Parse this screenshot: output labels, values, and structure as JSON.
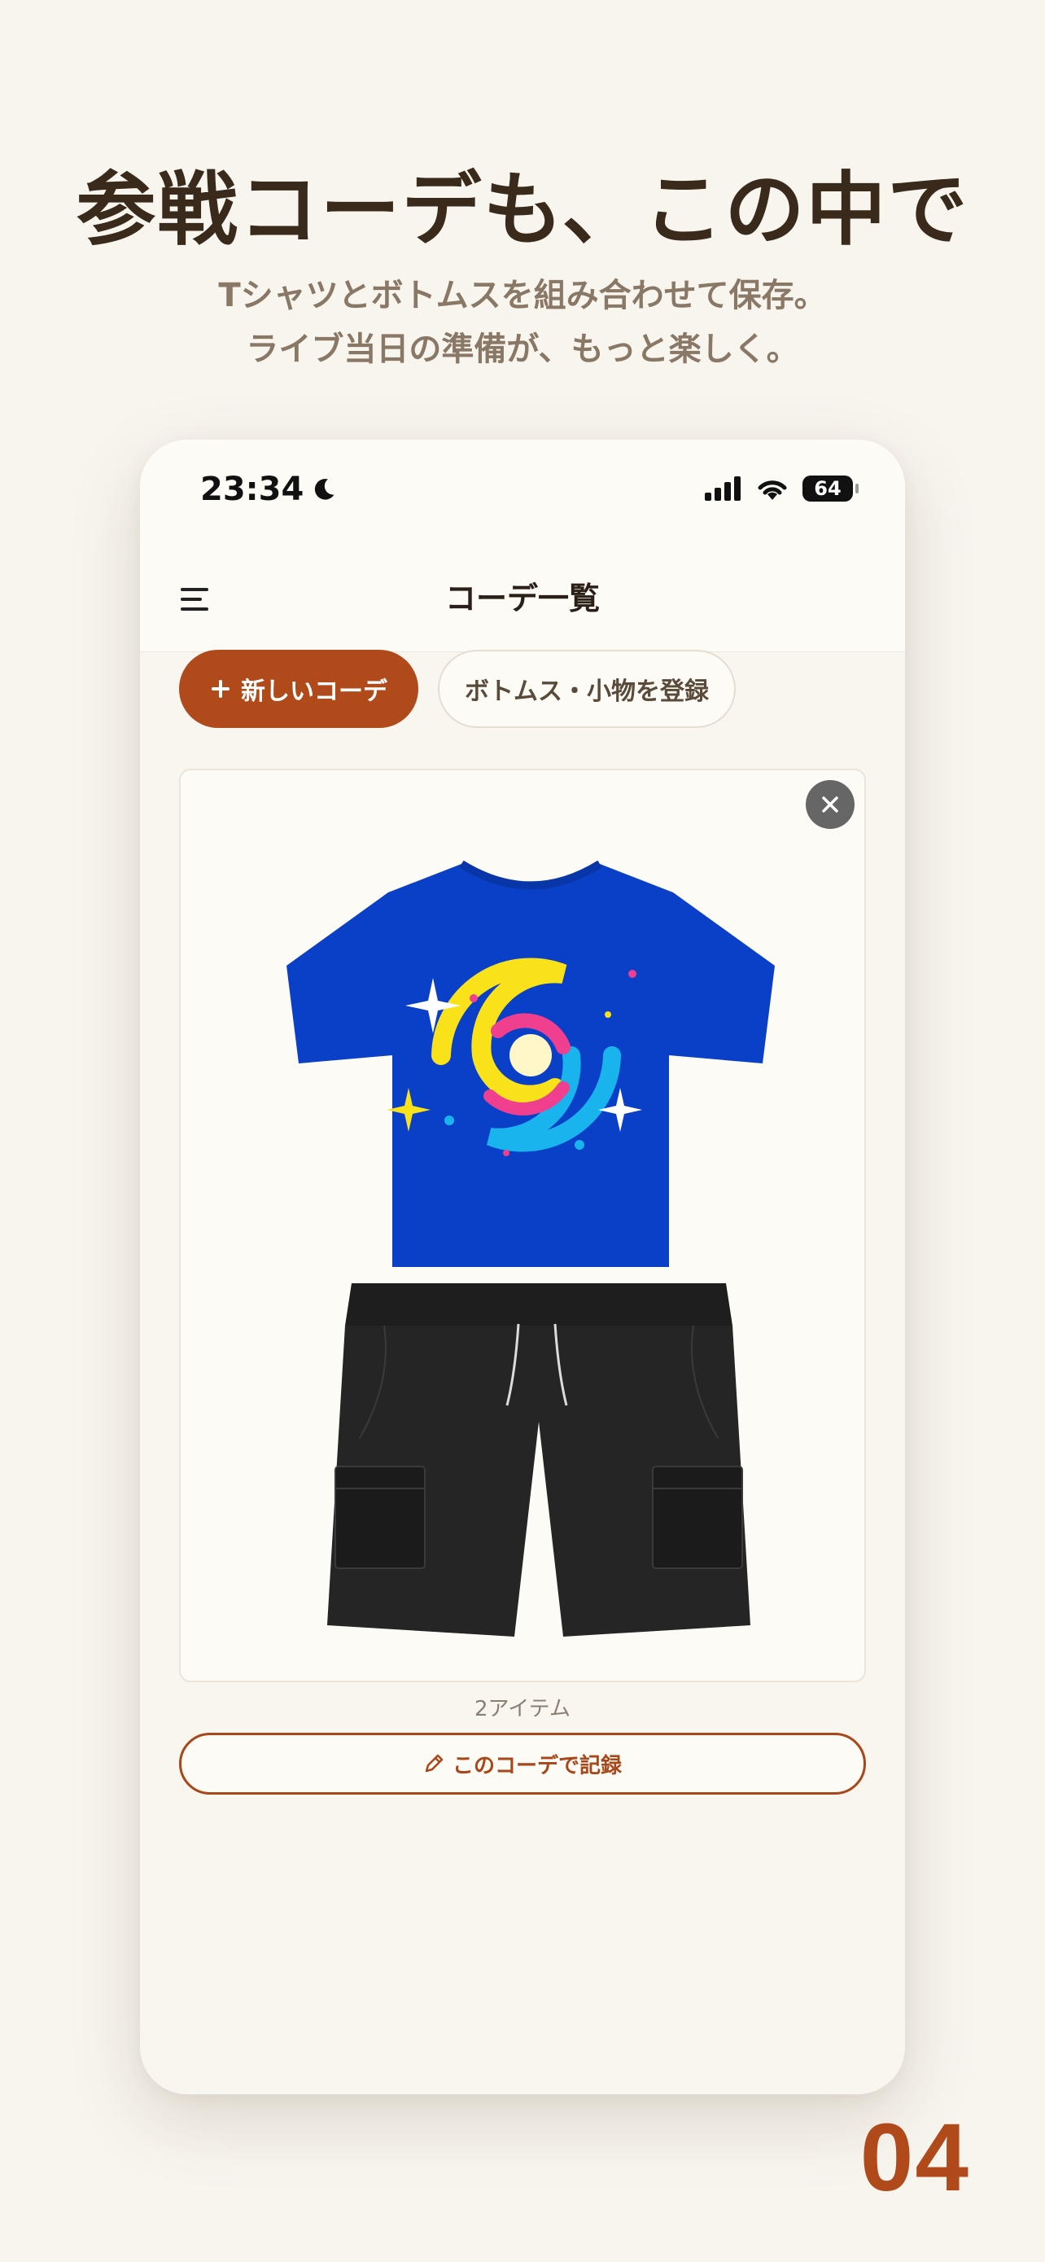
{
  "headline": "参戦コーデも、この中で",
  "subtitle_lines": [
    "Tシャツとボトムスを組み合わせて保存。",
    "ライブ当日の準備が、もっと楽しく。"
  ],
  "status_bar": {
    "time": "23:34",
    "battery": "64"
  },
  "nav": {
    "title": "コーデ一覧"
  },
  "actions": {
    "new_label": "新しいコーデ",
    "register_label": "ボトムス・小物を登録"
  },
  "outfit_card": {
    "items": [
      "t-shirt",
      "cargo-shorts"
    ],
    "item_count": "2アイテム",
    "record_label": "このコーデで記録"
  },
  "page_number": "04",
  "colors": {
    "accent": "#b04a1b",
    "background": "#f8f5ef",
    "shirt": "#0a3fc8"
  }
}
